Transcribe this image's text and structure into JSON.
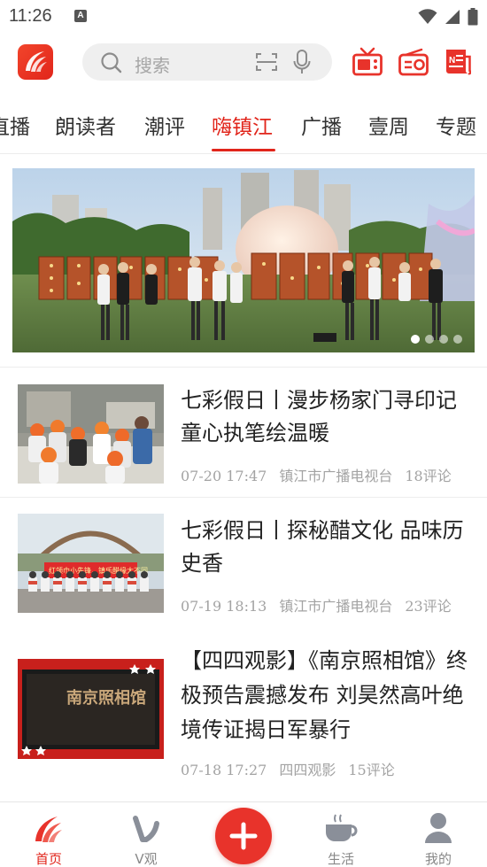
{
  "status_bar": {
    "time": "11:26",
    "notification_badge": "A"
  },
  "header": {
    "logo_icon": "app-logo-icon",
    "search_placeholder": "搜索",
    "right_icons": [
      "tv-icon",
      "radio-icon",
      "newspaper-icon"
    ]
  },
  "tabs": {
    "items": [
      "直播",
      "朗读者",
      "潮评",
      "嗨镇江",
      "广播",
      "壹周",
      "专题"
    ],
    "active": "嗨镇江"
  },
  "banner": {
    "slide_count": 4,
    "active_slide": 1
  },
  "news": [
    {
      "title": "七彩假日丨漫步杨家门寻印记 童心执笔绘温暖",
      "date": "07-20 17:47",
      "source": "镇江市广播电视台",
      "comments": "18评论"
    },
    {
      "title": "七彩假日丨探秘醋文化 品味历史香",
      "date": "07-19 18:13",
      "source": "镇江市广播电视台",
      "comments": "23评论",
      "thumb_banner_text": "红领巾小先锋，镇乐醋缘大不同"
    },
    {
      "title": "【四四观影】《南京照相馆》终极预告震撼发布 刘昊然高叶绝境传证揭日军暴行",
      "date": "07-18 17:27",
      "source": "四四观影",
      "comments": "15评论",
      "thumb_text": "南京照相馆"
    }
  ],
  "bottom_nav": {
    "items": [
      {
        "label": "首页",
        "icon": "home-logo-icon",
        "active": true
      },
      {
        "label": "V观",
        "icon": "v-icon",
        "active": false
      },
      {
        "label": "",
        "icon": "add-icon",
        "active": false
      },
      {
        "label": "生活",
        "icon": "coffee-cup-icon",
        "active": false
      },
      {
        "label": "我的",
        "icon": "person-icon",
        "active": false
      }
    ]
  },
  "colors": {
    "accent": "#e1251b",
    "meta_text": "#a3a3a3",
    "search_bg": "#efefef"
  }
}
